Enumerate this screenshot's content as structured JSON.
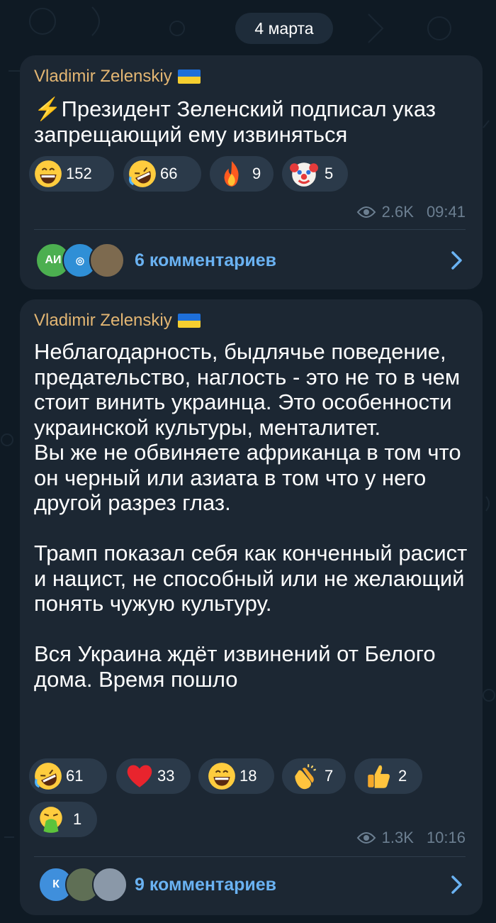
{
  "date": "4 марта",
  "posts": [
    {
      "author": "Vladimir Zelenskiy",
      "text": "⚡Президент Зеленский подписал указ запрещающий ему извиняться",
      "reactions": [
        {
          "icon": "grinning-face-icon",
          "count": "152"
        },
        {
          "icon": "rofl-face-icon",
          "count": "66"
        },
        {
          "icon": "fire-icon",
          "count": "9"
        },
        {
          "icon": "clown-face-icon",
          "count": "5"
        }
      ],
      "views": "2.6K",
      "time": "09:41",
      "comments": {
        "label": "6 комментариев",
        "avatar_text": "АИ"
      }
    },
    {
      "author": "Vladimir Zelenskiy",
      "text": "Неблагодарность, быдлячье поведение, предательство, наглость - это не то в чем стоит винить украинца. Это особенности украинской культуры, менталитет.\nВы же не обвиняете африканца в том что он черный или азиата в том что у него другой разрез глаз.\n\nТрамп показал себя как конченный расист и нацист, не способный или не желающий понять чужую культуру.\n\nВся Украина ждёт извинений от Белого дома. Время пошло",
      "reactions": [
        {
          "icon": "rofl-face-icon",
          "count": "61"
        },
        {
          "icon": "red-heart-icon",
          "count": "33"
        },
        {
          "icon": "grinning-face-icon",
          "count": "18"
        },
        {
          "icon": "clapping-hands-icon",
          "count": "7"
        },
        {
          "icon": "thumbs-up-icon",
          "count": "2"
        },
        {
          "icon": "vomiting-face-icon",
          "count": "1"
        }
      ],
      "views": "1.3K",
      "time": "10:16",
      "comments": {
        "label": "9 комментариев",
        "avatar_text": "К"
      }
    }
  ]
}
